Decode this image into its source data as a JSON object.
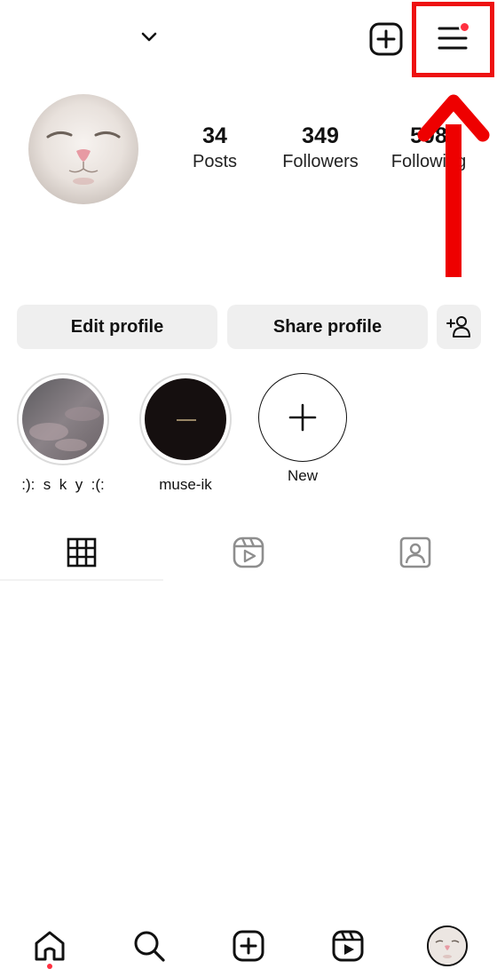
{
  "topbar": {
    "chevron_icon": "chevron-down-icon",
    "create_icon": "plus-square-icon",
    "menu_icon": "hamburger-menu-icon",
    "menu_has_notification": true,
    "accent": "#ff3040",
    "highlight_box_color": "#ee1111"
  },
  "profile": {
    "avatar": "cat-face-avatar",
    "stats": [
      {
        "value": "34",
        "label": "Posts"
      },
      {
        "value": "349",
        "label": "Followers"
      },
      {
        "value": "508",
        "label": "Following"
      }
    ]
  },
  "actions": {
    "edit_label": "Edit profile",
    "share_label": "Share profile",
    "add_user_icon": "add-person-icon"
  },
  "highlights": [
    {
      "label": ":):  s  k  y  :(:"
    },
    {
      "label": "muse-ik"
    },
    {
      "label": "New"
    }
  ],
  "tabs": [
    {
      "icon": "grid-icon",
      "active": true
    },
    {
      "icon": "reels-icon",
      "active": false
    },
    {
      "icon": "tagged-icon",
      "active": false
    }
  ],
  "bottom_nav": [
    {
      "icon": "home-icon",
      "notification": true
    },
    {
      "icon": "search-icon"
    },
    {
      "icon": "create-icon"
    },
    {
      "icon": "reels-icon"
    },
    {
      "icon": "profile-avatar"
    }
  ],
  "annotation": {
    "arrow_color": "#ee0000"
  }
}
